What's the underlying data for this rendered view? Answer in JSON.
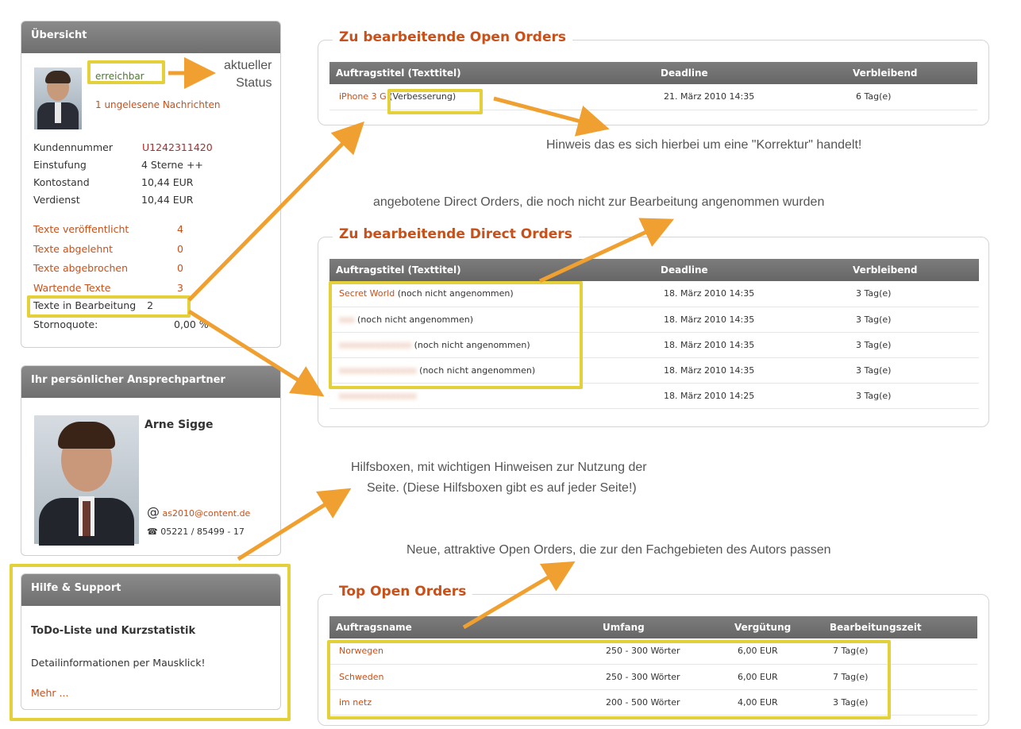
{
  "overview": {
    "header": "Übersicht",
    "status": "erreichbar",
    "unread": "1 ungelesene Nachrichten",
    "stats": [
      {
        "label": "Kundennummer",
        "value": "U1242311420"
      },
      {
        "label": "Einstufung",
        "value": "4 Sterne ++"
      },
      {
        "label": "Kontostand",
        "value": "10,44 EUR"
      },
      {
        "label": "Verdienst",
        "value": "10,44 EUR"
      }
    ],
    "texts": [
      {
        "label": "Texte veröffentlicht",
        "value": "4"
      },
      {
        "label": "Texte abgelehnt",
        "value": "0"
      },
      {
        "label": "Texte abgebrochen",
        "value": "0"
      },
      {
        "label": "Wartende Texte",
        "value": "3"
      }
    ],
    "in_progress": {
      "label": "Texte in Bearbeitung",
      "value": "2"
    },
    "cancel_rate": {
      "label": "Stornoquote:",
      "value": "0,00 %"
    }
  },
  "contact": {
    "header": "Ihr persönlicher Ansprechpartner",
    "name": "Arne Sigge",
    "email": "as2010@content.de",
    "phone": "05221 / 85499 - 17"
  },
  "help": {
    "header": "Hilfe & Support",
    "title": "ToDo-Liste und Kurzstatistik",
    "text": "Detailinformationen per Mausklick!",
    "more": "Mehr ..."
  },
  "open_orders": {
    "legend": "Zu bearbeitende Open Orders",
    "columns": [
      "Auftragstitel (Texttitel)",
      "Deadline",
      "Verbleibend"
    ],
    "rows": [
      {
        "title": "iPhone 3 G",
        "note": "(Verbesserung)",
        "deadline": "21. März 2010 14:35",
        "remaining": "6 Tag(e)"
      }
    ]
  },
  "direct_orders": {
    "legend": "Zu bearbeitende Direct Orders",
    "columns": [
      "Auftragstitel (Texttitel)",
      "Deadline",
      "Verbleibend"
    ],
    "rows": [
      {
        "title": "Secret World",
        "note": "(noch nicht angenommen)",
        "deadline": "18. März 2010 14:35",
        "remaining": "3 Tag(e)"
      },
      {
        "title": "xxx",
        "note": "(noch nicht angenommen)",
        "deadline": "18. März 2010 14:35",
        "remaining": "3 Tag(e)"
      },
      {
        "title": "xxxxxxxxxxxxxx",
        "note": "(noch nicht angenommen)",
        "deadline": "18. März 2010 14:35",
        "remaining": "3 Tag(e)"
      },
      {
        "title": "xxxxxxxxxxxxxxx",
        "note": "(noch nicht angenommen)",
        "deadline": "18. März 2010 14:35",
        "remaining": "3 Tag(e)"
      },
      {
        "title": "xxxxxxxxxxxxxxx",
        "note": "",
        "deadline": "18. März 2010 14:25",
        "remaining": "3 Tag(e)"
      }
    ]
  },
  "top_orders": {
    "legend": "Top Open Orders",
    "columns": [
      "Auftragsname",
      "Umfang",
      "Vergütung",
      "Bearbeitungszeit"
    ],
    "rows": [
      {
        "name": "Norwegen",
        "scope": "250 - 300 Wörter",
        "pay": "6,00 EUR",
        "time": "7 Tag(e)"
      },
      {
        "name": "Schweden",
        "scope": "250 - 300 Wörter",
        "pay": "6,00 EUR",
        "time": "7 Tag(e)"
      },
      {
        "name": "im netz",
        "scope": "200 - 500 Wörter",
        "pay": "4,00 EUR",
        "time": "3 Tag(e)"
      }
    ]
  },
  "annotations": {
    "status": "aktueller\nStatus",
    "correction": "Hinweis das es sich hierbei um eine \"Korrektur\" handelt!",
    "direct_offer": "angebotene Direct Orders, die noch nicht zur Bearbeitung angenommen wurden",
    "help_boxes_1": "Hilfsboxen, mit wichtigen Hinweisen zur Nutzung der",
    "help_boxes_2": "Seite. (Diese Hilfsboxen gibt es auf jeder Seite!)",
    "top_orders": "Neue, attraktive Open Orders, die zur den Fachgebieten des Autors passen"
  },
  "colors": {
    "accent": "#c8501a",
    "highlight": "#e3d03a",
    "arrow": "#f0a030"
  }
}
